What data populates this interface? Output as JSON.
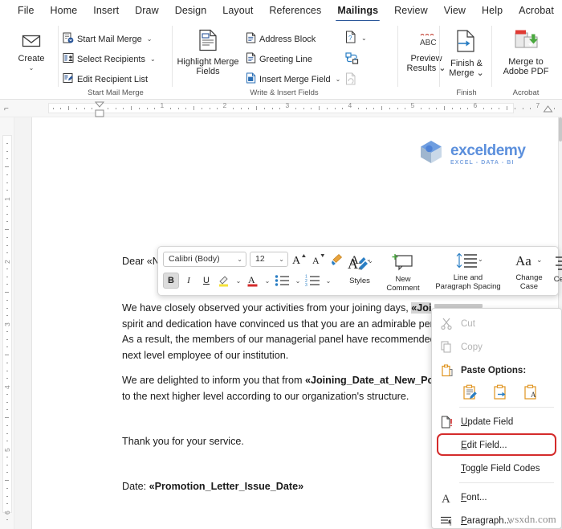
{
  "app": {
    "tabs": [
      {
        "label": "File",
        "active": false
      },
      {
        "label": "Home",
        "active": false
      },
      {
        "label": "Insert",
        "active": false
      },
      {
        "label": "Draw",
        "active": false
      },
      {
        "label": "Design",
        "active": false
      },
      {
        "label": "Layout",
        "active": false
      },
      {
        "label": "References",
        "active": false
      },
      {
        "label": "Mailings",
        "active": true
      },
      {
        "label": "Review",
        "active": false
      },
      {
        "label": "View",
        "active": false
      },
      {
        "label": "Help",
        "active": false
      },
      {
        "label": "Acrobat",
        "active": false
      }
    ],
    "accent_color": "#2b579a"
  },
  "ribbon": {
    "groups": [
      {
        "name": "create",
        "label": "Create",
        "group_label": ""
      },
      {
        "name": "start_mail_merge",
        "group_label": "Start Mail Merge"
      },
      {
        "name": "write_insert_fields",
        "group_label": "Write & Insert Fields"
      },
      {
        "name": "preview_results",
        "group_label": ""
      },
      {
        "name": "finish",
        "group_label": "Finish"
      },
      {
        "name": "acrobat",
        "group_label": "Acrobat"
      }
    ],
    "create": {
      "label": "Create",
      "icon": "envelope-icon"
    },
    "start_mail_merge": {
      "group_label": "Start Mail Merge",
      "items": [
        {
          "label": "Start Mail Merge",
          "icon": "start-mail-merge-icon",
          "caret": "⌄"
        },
        {
          "label": "Select Recipients",
          "icon": "select-recipients-icon",
          "caret": "⌄"
        },
        {
          "label": "Edit Recipient List",
          "icon": "edit-recipient-list-icon",
          "caret": ""
        }
      ]
    },
    "write_insert_fields": {
      "group_label": "Write & Insert Fields",
      "highlight": {
        "label": "Highlight Merge Fields",
        "icon": "highlight-merge-fields-icon"
      },
      "items": [
        {
          "label": "Address Block",
          "icon": "address-block-icon"
        },
        {
          "label": "Greeting Line",
          "icon": "greeting-line-icon"
        },
        {
          "label": "Insert Merge Field",
          "icon": "insert-merge-field-icon",
          "caret": "⌄"
        }
      ],
      "right_icons": [
        {
          "name": "rules-icon",
          "caret": "⌄",
          "disabled": false
        },
        {
          "name": "match-fields-icon",
          "caret": "",
          "disabled": false
        },
        {
          "name": "update-labels-icon",
          "caret": "",
          "disabled": true
        }
      ]
    },
    "preview_results": {
      "label_line1": "Preview",
      "label_line2": "Results",
      "caret": "⌄",
      "icon": "abc-preview-icon",
      "abc": "ABC"
    },
    "finish": {
      "group_label": "Finish",
      "label_line1": "Finish &",
      "label_line2": "Merge",
      "caret": "⌄",
      "icon": "finish-merge-icon"
    },
    "acrobat": {
      "group_label": "Acrobat",
      "label_line1": "Merge to",
      "label_line2": "Adobe PDF",
      "icon": "merge-to-adobe-pdf-icon"
    }
  },
  "ruler": {
    "horizontal_numbers": [
      "1",
      "2",
      "3",
      "4",
      "5",
      "6"
    ],
    "vertical_numbers": [
      "1",
      "2",
      "3",
      "4",
      "5"
    ],
    "corner_icon": "tab-stop-icon"
  },
  "document": {
    "logo": {
      "name": "exceldemy",
      "tagline": "EXCEL - DATA - BI",
      "icon": "exceldemy-cube-icon",
      "color": "#5b8fdc"
    },
    "salutation": "Dear «Nam",
    "paragraph1": [
      "We have closely observed your activities from your joining days, ",
      "«Join",
      "spirit and dedication have convinced us that you are an admirable per",
      "As a result, the members of our managerial panel have recommended",
      "next level employee of our institution."
    ],
    "paragraph1_line1_prefix": "We have closely observed your activities from your joining days, ",
    "paragraph1_line1_field": "«Joi",
    "paragraph1_line2": "spirit and dedication have convinced us that you are an admirable per",
    "paragraph1_line3": "As a result, the members of our managerial panel have recommended",
    "paragraph1_line4": "next level employee of our institution.",
    "paragraph2_prefix": "We are delighted to inform you that from ",
    "paragraph2_field": "«Joining_Date_at_New_Positi",
    "paragraph2_line2": "to the next higher level according to our organization's structure.",
    "closing": "Thank you for your service.",
    "date_label": "Date: ",
    "date_field": "«Promotion_Letter_Issue_Date»"
  },
  "mini_toolbar": {
    "font_name": "Calibri (Body)",
    "font_size": "12",
    "buttons_row1": [
      {
        "name": "grow-font-icon",
        "label": "A"
      },
      {
        "name": "shrink-font-icon",
        "label": "A"
      },
      {
        "name": "format-painter-icon",
        "label": ""
      },
      {
        "name": "text-highlight-style-icon",
        "label": "A"
      }
    ],
    "buttons_row2": [
      {
        "name": "bold-button",
        "label": "B",
        "pressed": true
      },
      {
        "name": "italic-button",
        "label": "I",
        "pressed": false
      },
      {
        "name": "underline-button",
        "label": "U",
        "pressed": false
      },
      {
        "name": "highlight-color-button",
        "label": "",
        "pressed": false
      },
      {
        "name": "font-color-button",
        "label": "A",
        "pressed": false
      },
      {
        "name": "bullets-button",
        "label": "",
        "pressed": false
      },
      {
        "name": "numbering-button",
        "label": "",
        "pressed": false
      }
    ],
    "stacks": [
      {
        "name": "styles-button",
        "label": "Styles",
        "icon": "styles-icon"
      },
      {
        "name": "new-comment-button",
        "label_line1": "New",
        "label_line2": "Comment",
        "icon": "new-comment-icon"
      },
      {
        "name": "line-paragraph-spacing-button",
        "label_line1": "Line and",
        "label_line2": "Paragraph Spacing",
        "icon": "line-spacing-icon",
        "caret": "⌄"
      },
      {
        "name": "change-case-button",
        "label_line1": "Change",
        "label_line2": "Case",
        "icon": "change-case-icon",
        "glyph": "Aa",
        "caret": "⌄"
      },
      {
        "name": "center-button",
        "label": "Center",
        "icon": "align-center-icon"
      }
    ]
  },
  "context_menu": {
    "items": [
      {
        "name": "cut",
        "label": "Cut",
        "underline": "C",
        "icon": "scissors-icon",
        "disabled": true
      },
      {
        "name": "copy",
        "label": "Copy",
        "underline": "",
        "icon": "copy-icon",
        "disabled": true
      },
      {
        "name": "paste-options",
        "label": "Paste Options:",
        "icon": "clipboard-icon",
        "disabled": false,
        "header": true
      },
      {
        "name": "update-field",
        "label": "Update Field",
        "underline": "U",
        "icon": "update-field-icon",
        "disabled": false
      },
      {
        "name": "edit-field",
        "label": "Edit Field...",
        "underline": "E",
        "icon": "",
        "disabled": false,
        "highlighted": true
      },
      {
        "name": "toggle-field-codes",
        "label": "Toggle Field Codes",
        "underline": "T",
        "icon": "",
        "disabled": false
      },
      {
        "name": "font",
        "label": "Font...",
        "underline": "F",
        "icon": "font-a-icon",
        "disabled": false
      },
      {
        "name": "paragraph",
        "label": "Paragraph...",
        "underline": "P",
        "icon": "paragraph-icon",
        "disabled": false
      }
    ],
    "paste_buttons": [
      {
        "name": "keep-source-formatting-icon",
        "label": ""
      },
      {
        "name": "merge-formatting-icon",
        "label": ""
      },
      {
        "name": "keep-text-only-icon",
        "label": "A"
      }
    ],
    "highlight_color": "#d42b2b"
  },
  "watermark": "wsxdn.com"
}
